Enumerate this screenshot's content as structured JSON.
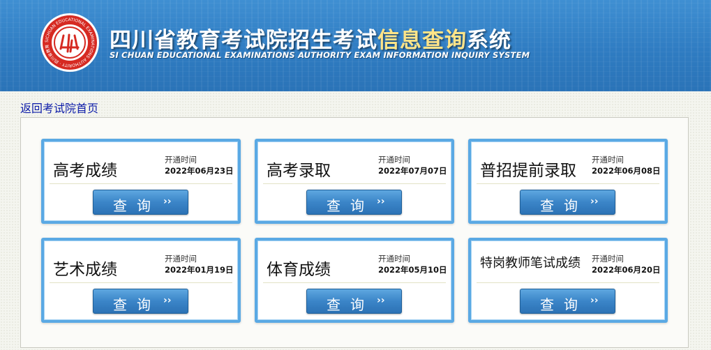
{
  "header": {
    "title_part1": "四川省教育考试院招生考试",
    "title_highlight": "信息查询",
    "title_part2": "系统",
    "subtitle": "SI CHUAN EDUCATIONAL EXAMINATIONS AUTHORITY EXAM INFORMATION INQUIRY SYSTEM",
    "logo_ring_text": "SICHUAN EDUCATIONAL EXAMINATIONS AUTHORITY · 四川省教育考试院",
    "logo_icon": "sichuan-exam-authority-seal"
  },
  "nav": {
    "back_link": "返回考试院首页"
  },
  "labels": {
    "open_time": "开通时间"
  },
  "cards": [
    {
      "name": "高考成绩",
      "date": "2022年06月23日",
      "button": "查询",
      "arrow": "››"
    },
    {
      "name": "高考录取",
      "date": "2022年07月07日",
      "button": "查询",
      "arrow": "››"
    },
    {
      "name": "普招提前录取",
      "date": "2022年06月08日",
      "button": "查询",
      "arrow": "››"
    },
    {
      "name": "艺术成绩",
      "date": "2022年01月19日",
      "button": "查询",
      "arrow": "››"
    },
    {
      "name": "体育成绩",
      "date": "2022年05月10日",
      "button": "查询",
      "arrow": "››"
    },
    {
      "name": "特岗教师笔试成绩",
      "date": "2022年06月20日",
      "button": "查询",
      "arrow": "››"
    }
  ],
  "colors": {
    "header_blue": "#2f7cc2",
    "title_highlight": "#ffe488",
    "card_border": "#5aa9e4",
    "button_blue": "#3b85c8",
    "logo_red": "#d62a22",
    "link_blue": "#0b1aa8"
  }
}
